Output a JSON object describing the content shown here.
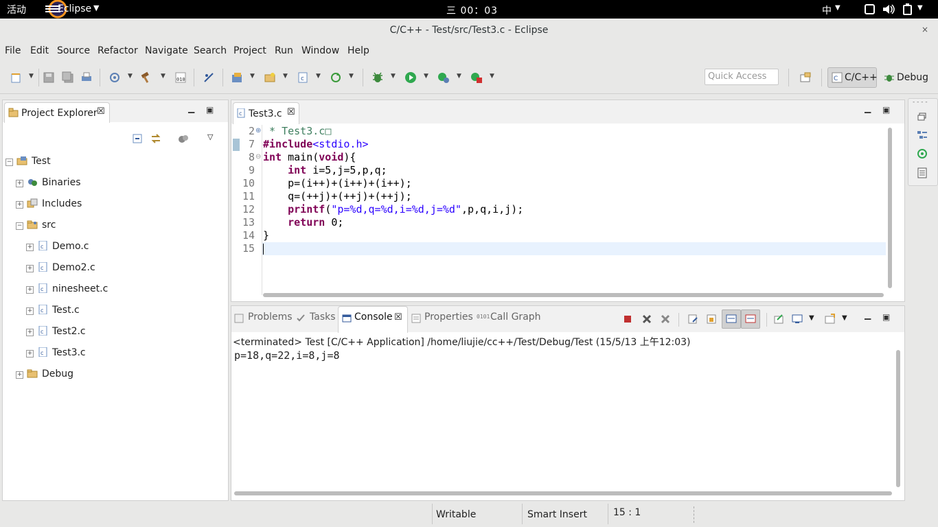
{
  "topbar": {
    "activities": "活动",
    "app_name": "Eclipse",
    "clock": "三 00：03",
    "ime": "中"
  },
  "window": {
    "title": "C/C++ - Test/src/Test3.c - Eclipse",
    "close": "×"
  },
  "menu": [
    "File",
    "Edit",
    "Source",
    "Refactor",
    "Navigate",
    "Search",
    "Project",
    "Run",
    "Window",
    "Help"
  ],
  "toolbar": {
    "quick_access_placeholder": "Quick Access",
    "perspective_cpp": "C/C++",
    "perspective_debug": "Debug"
  },
  "project_explorer": {
    "tab_label": "Project Explorer",
    "tree": [
      {
        "label": "Test",
        "level": 0,
        "expanded": true,
        "icon": "project-icon"
      },
      {
        "label": "Binaries",
        "level": 1,
        "expanded": false,
        "icon": "binaries-icon"
      },
      {
        "label": "Includes",
        "level": 1,
        "expanded": false,
        "icon": "includes-icon"
      },
      {
        "label": "src",
        "level": 1,
        "expanded": true,
        "icon": "source-folder-icon"
      },
      {
        "label": "Demo.c",
        "level": 2,
        "expanded": false,
        "icon": "c-file-icon"
      },
      {
        "label": "Demo2.c",
        "level": 2,
        "expanded": false,
        "icon": "c-file-icon"
      },
      {
        "label": "ninesheet.c",
        "level": 2,
        "expanded": false,
        "icon": "c-file-icon"
      },
      {
        "label": "Test.c",
        "level": 2,
        "expanded": false,
        "icon": "c-file-icon"
      },
      {
        "label": "Test2.c",
        "level": 2,
        "expanded": false,
        "icon": "c-file-icon"
      },
      {
        "label": "Test3.c",
        "level": 2,
        "expanded": false,
        "icon": "c-file-icon"
      },
      {
        "label": "Debug",
        "level": 1,
        "expanded": false,
        "icon": "folder-icon"
      }
    ]
  },
  "editor": {
    "tab_label": "Test3.c",
    "line_numbers": [
      "2",
      "7",
      "8",
      "9",
      "10",
      "11",
      "12",
      "13",
      "14",
      "15"
    ],
    "lines": [
      {
        "parts": [
          {
            "t": " * Test3.c",
            "c": "cm"
          },
          {
            "t": "□",
            "c": "cm"
          }
        ]
      },
      {
        "parts": [
          {
            "t": "#include",
            "c": "pp"
          },
          {
            "t": "<stdio.h>",
            "c": "hdr"
          }
        ]
      },
      {
        "parts": [
          {
            "t": "int",
            "c": "kw"
          },
          {
            "t": " main(",
            "c": ""
          },
          {
            "t": "void",
            "c": "kw"
          },
          {
            "t": "){",
            "c": ""
          }
        ]
      },
      {
        "parts": [
          {
            "t": "    ",
            "c": ""
          },
          {
            "t": "int",
            "c": "kw"
          },
          {
            "t": " i=5,j=5,p,q;",
            "c": ""
          }
        ]
      },
      {
        "parts": [
          {
            "t": "    p=(i++)+(i++)+(i++);",
            "c": ""
          }
        ]
      },
      {
        "parts": [
          {
            "t": "    q=(++j)+(++j)+(++j);",
            "c": ""
          }
        ]
      },
      {
        "parts": [
          {
            "t": "    ",
            "c": ""
          },
          {
            "t": "printf",
            "c": "kw"
          },
          {
            "t": "(",
            "c": ""
          },
          {
            "t": "\"p=%d,q=%d,i=%d,j=%d\"",
            "c": "str"
          },
          {
            "t": ",p,q,i,j);",
            "c": ""
          }
        ]
      },
      {
        "parts": [
          {
            "t": "    ",
            "c": ""
          },
          {
            "t": "return",
            "c": "kw"
          },
          {
            "t": " 0;",
            "c": ""
          }
        ]
      },
      {
        "parts": [
          {
            "t": "}",
            "c": ""
          }
        ]
      },
      {
        "parts": [
          {
            "t": "",
            "c": ""
          }
        ]
      }
    ]
  },
  "console": {
    "tabs": [
      "Problems",
      "Tasks",
      "Console",
      "Properties",
      "Call Graph"
    ],
    "header": "<terminated> Test [C/C++ Application] /home/liujie/cc++/Test/Debug/Test (15/5/13 上午12:03)",
    "output": "p=18,q=22,i=8,j=8"
  },
  "status": {
    "writable": "Writable",
    "insert_mode": "Smart Insert",
    "position": "15 : 1"
  }
}
